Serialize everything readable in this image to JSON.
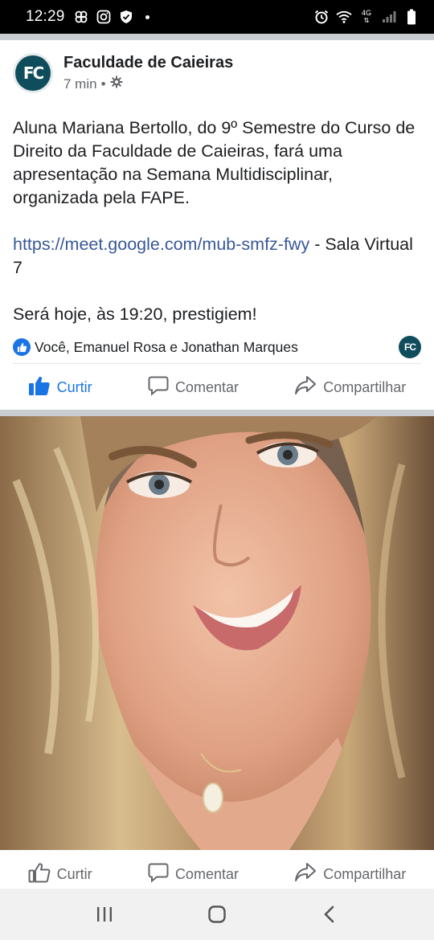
{
  "status_bar": {
    "time": "12:29",
    "network": "4G"
  },
  "post": {
    "page_name": "Faculdade de Caieiras",
    "avatar_initials": "FC",
    "time_ago": "7 min",
    "separator": "•",
    "text_paragraph_1": "Aluna Mariana Bertollo, do 9º Semestre do Curso de Direito da Faculdade de Caieiras, fará uma apresentação na Semana Multidisciplinar, organizada pela FAPE.",
    "link_url": "https://meet.google.com/mub-smfz-fwy",
    "link_suffix": " - Sala Virtual 7",
    "text_paragraph_3": "Será hoje, às 19:20, prestigiem!",
    "reactions_text": "Você, Emanuel Rosa e Jonathan Marques",
    "reactor_avatar_initials": "FC"
  },
  "actions_top": {
    "like_label": "Curtir",
    "comment_label": "Comentar",
    "share_label": "Compartilhar"
  },
  "actions_bottom": {
    "like_label": "Curtir",
    "comment_label": "Comentar",
    "share_label": "Compartilhar"
  },
  "colors": {
    "accent": "#1b74e4",
    "link": "#385898",
    "brand": "#0f4d5c",
    "muted": "#65676b"
  }
}
